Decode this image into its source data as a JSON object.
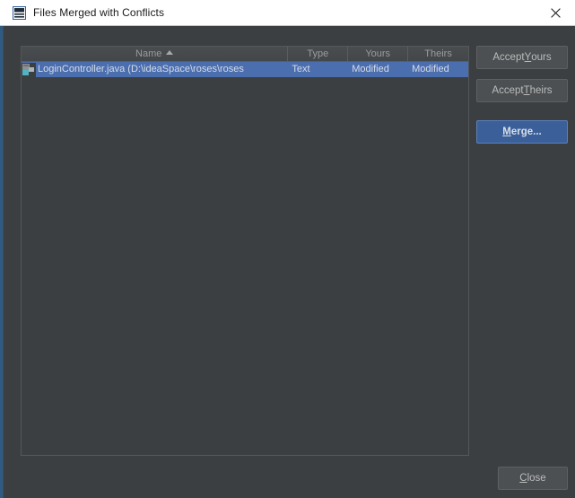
{
  "window": {
    "title": "Files Merged with Conflicts",
    "icon": "intellij-idea-icon",
    "close_icon": "close-icon"
  },
  "table": {
    "columns": [
      {
        "key": "name",
        "label": "Name",
        "sorted": "ascending",
        "sort_indicator": "▲"
      },
      {
        "key": "type",
        "label": "Type",
        "sorted": "none",
        "sort_indicator": ""
      },
      {
        "key": "yours",
        "label": "Yours",
        "sorted": "none",
        "sort_indicator": ""
      },
      {
        "key": "theirs",
        "label": "Theirs",
        "sorted": "none",
        "sort_indicator": ""
      }
    ],
    "rows": [
      {
        "icon": "java-class-file-icon",
        "name": "LoginController.java (D:\\ideaSpace\\roses\\roses",
        "type": "Text",
        "yours": "Modified",
        "theirs": "Modified",
        "selected": true
      }
    ]
  },
  "actions": {
    "accept_yours": {
      "label_before": "Accept ",
      "mnemonic": "Y",
      "label_after": "ours"
    },
    "accept_theirs": {
      "label_before": "Accept ",
      "mnemonic": "T",
      "label_after": "heirs"
    },
    "merge": {
      "label_before": "",
      "mnemonic": "M",
      "label_after": "erge..."
    },
    "close": {
      "label_before": "",
      "mnemonic": "C",
      "label_after": "lose"
    }
  },
  "colors": {
    "dialog_background": "#3c3f41",
    "titlebar_background": "#ffffff",
    "selection_blue": "#4b6eaf",
    "merge_button_blue": "#3b6099",
    "edge_accent": "#2d5b86",
    "button_face": "#4c5052",
    "text_primary": "#bbbbbb",
    "header_text": "#9a9c9e"
  }
}
